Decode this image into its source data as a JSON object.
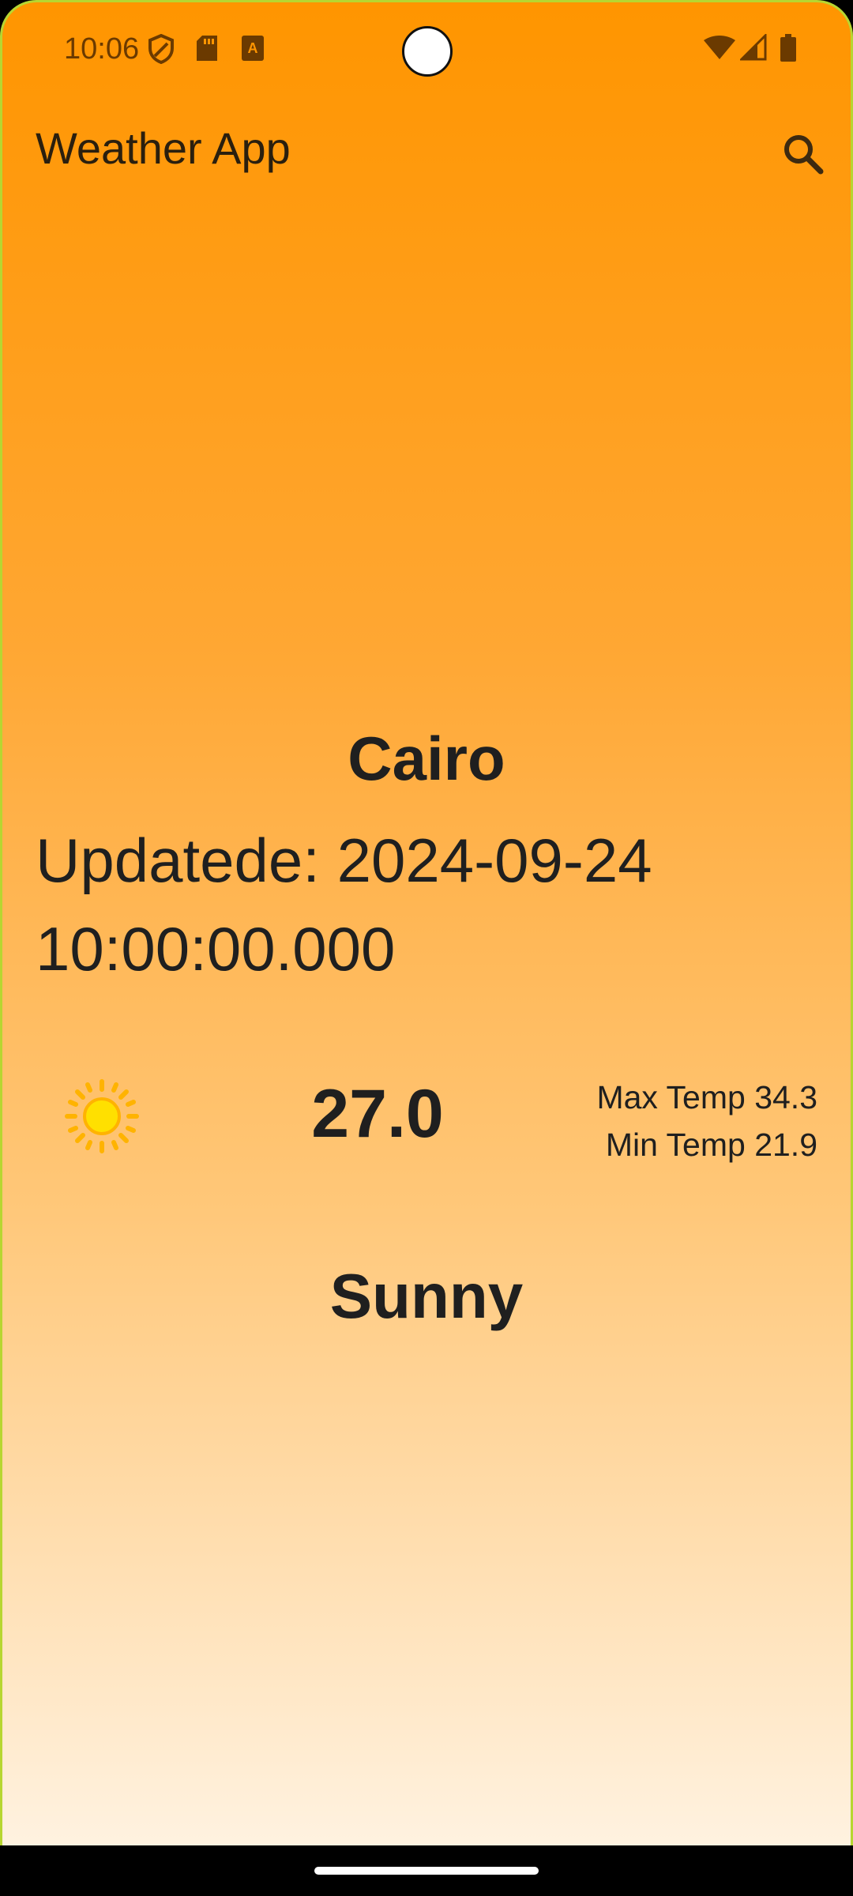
{
  "status_bar": {
    "time": "10:06",
    "icons": [
      "shield-icon",
      "sd-card-icon",
      "font-a-icon",
      "wifi-icon",
      "cellular-signal-icon",
      "battery-icon"
    ]
  },
  "app_bar": {
    "title": "Weather App",
    "search_icon": "search-icon"
  },
  "weather": {
    "city": "Cairo",
    "updated": "Updatede: 2024-09-24 10:00:00.000",
    "condition_icon": "sun-icon",
    "temperature": "27.0",
    "max_temp": "Max Temp 34.3",
    "min_temp": "Min Temp 21.9",
    "condition": "Sunny"
  },
  "colors": {
    "gradient_top": "#ff9500",
    "gradient_bottom": "#fff2e0",
    "text": "#1f1f1f",
    "status_icon": "#6b3a00"
  }
}
